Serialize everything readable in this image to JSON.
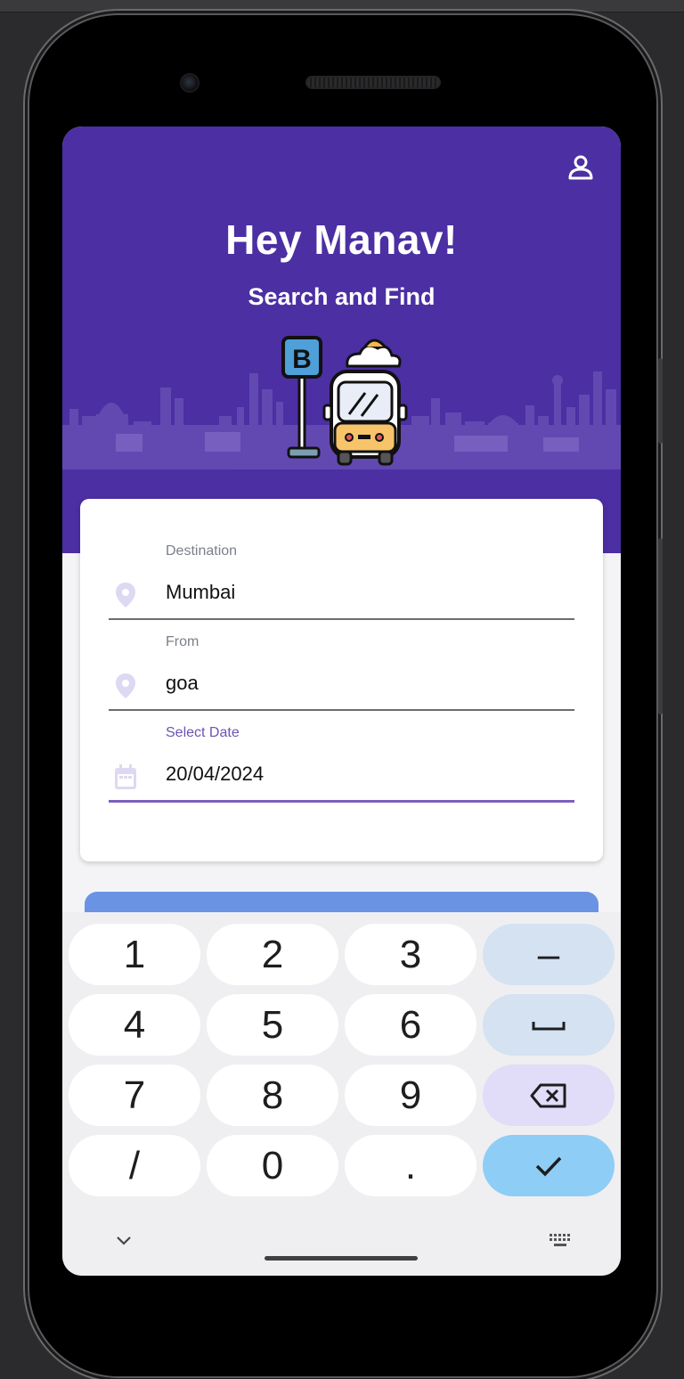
{
  "header": {
    "greeting": "Hey Manav!",
    "subtitle": "Search and Find",
    "profile_icon": "person-icon",
    "bg_color": "#4b2fa3",
    "illustration_sign_letter": "B"
  },
  "form": {
    "fields": [
      {
        "label": "Destination",
        "value": "Mumbai",
        "icon": "location-pin-icon"
      },
      {
        "label": "From",
        "value": "goa",
        "icon": "location-pin-icon"
      },
      {
        "label": "Select Date",
        "value": "20/04/2024",
        "icon": "calendar-icon"
      }
    ],
    "accent_color": "#7d5fc0"
  },
  "search_button": {
    "color": "#6b93e3"
  },
  "keyboard": {
    "rows": [
      [
        "1",
        "2",
        "3",
        "–"
      ],
      [
        "4",
        "5",
        "6",
        "␣"
      ],
      [
        "7",
        "8",
        "9",
        "⌫"
      ],
      [
        "/",
        "0",
        ".",
        "✓"
      ]
    ],
    "collapse_icon": "chevron-down-icon",
    "switch_icon": "keyboard-icon"
  }
}
